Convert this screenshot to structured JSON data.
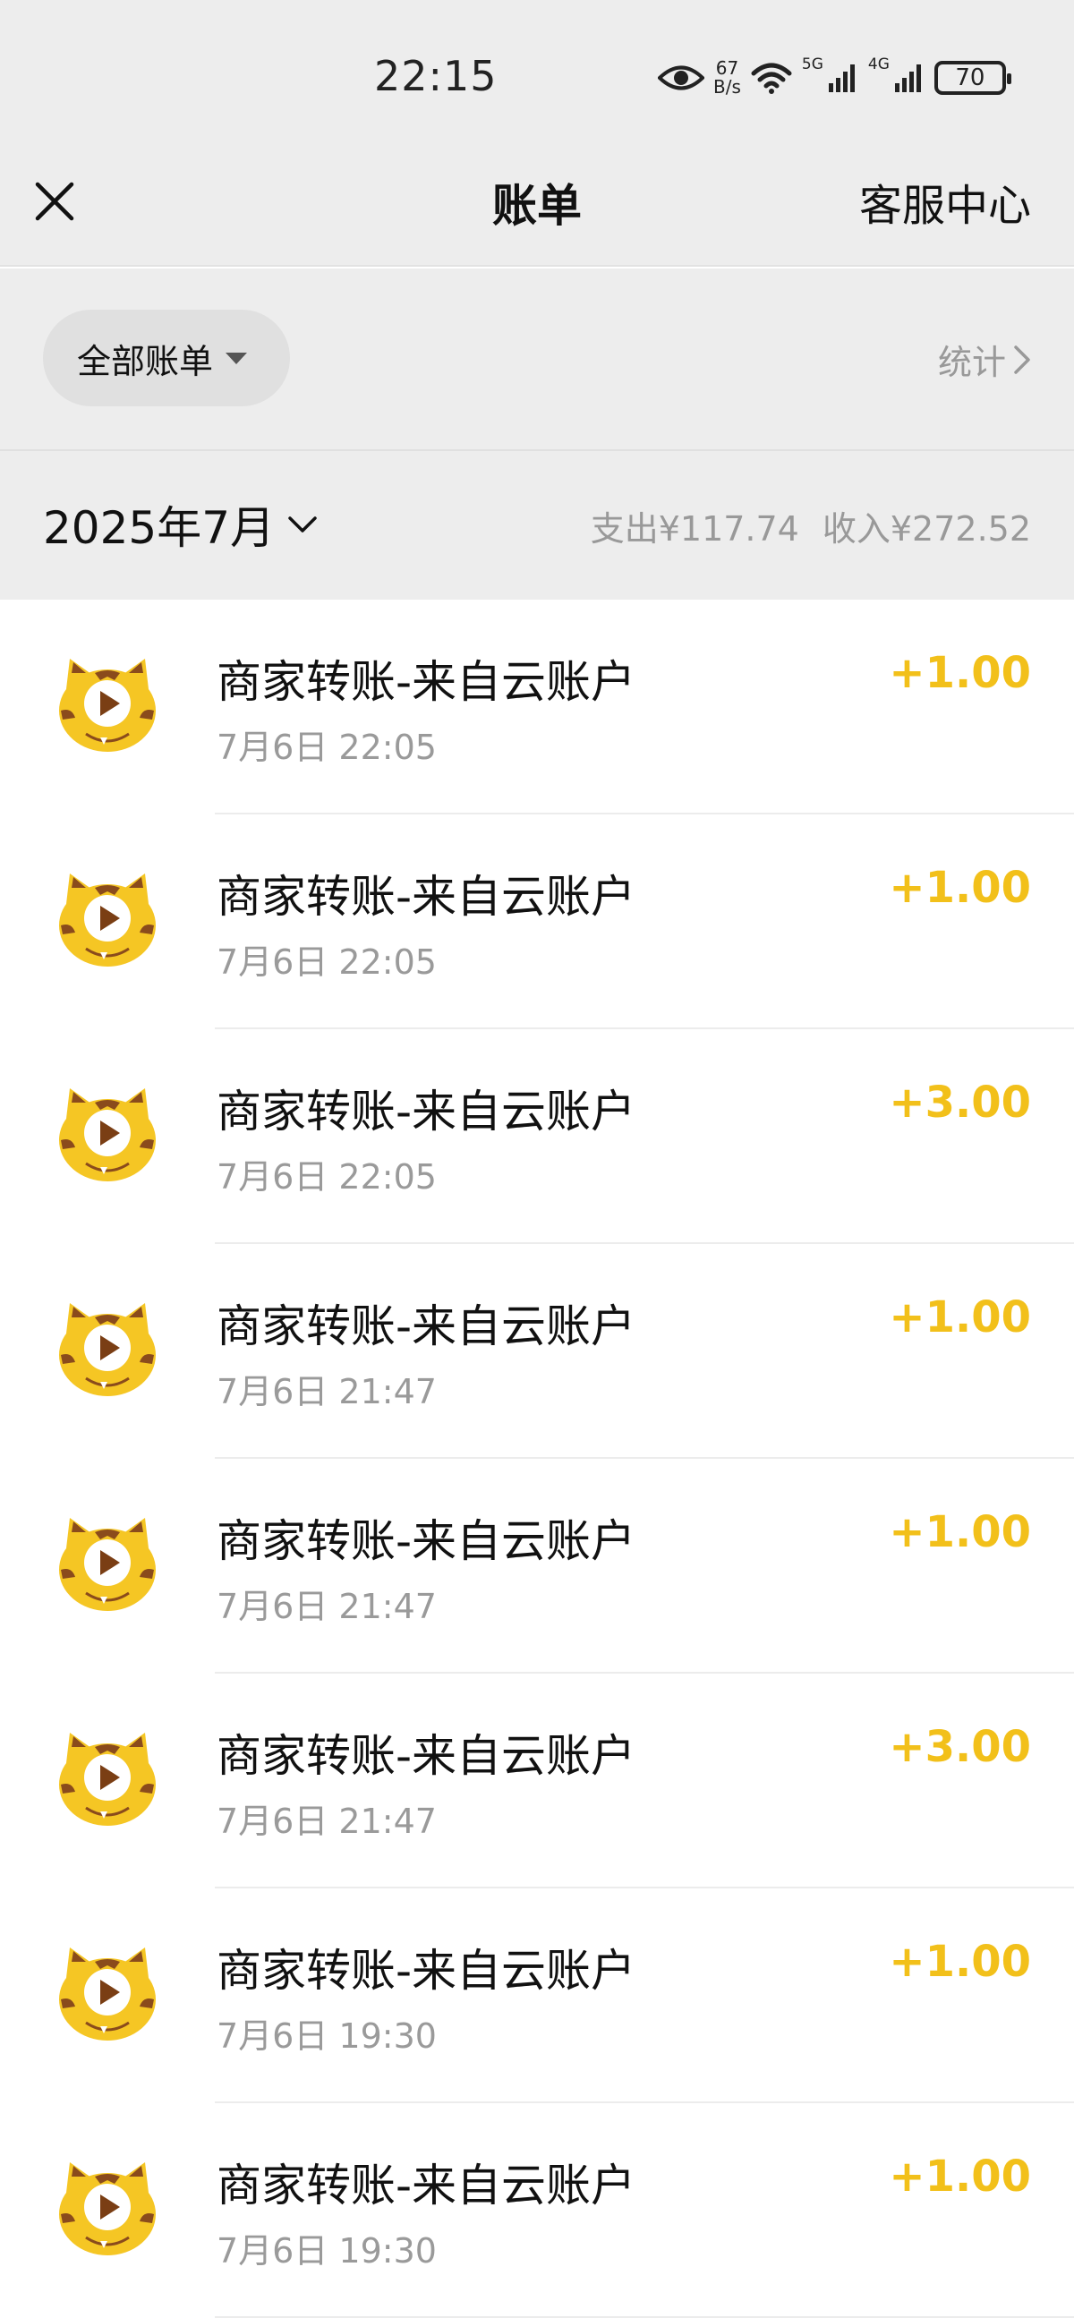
{
  "status_bar": {
    "time": "22:15",
    "net_speed_value": "67",
    "net_speed_unit": "B/s",
    "sim1": "5G",
    "sim2": "4G",
    "battery": "70"
  },
  "nav": {
    "title": "账单",
    "service": "客服中心"
  },
  "filter": {
    "label": "全部账单",
    "stats": "统计"
  },
  "month": {
    "label": "2025年7月",
    "expense": "支出¥117.74",
    "income": "收入¥272.52"
  },
  "transactions": [
    {
      "title": "商家转账-来自云账户",
      "time": "7月6日 22:05",
      "amount": "+1.00"
    },
    {
      "title": "商家转账-来自云账户",
      "time": "7月6日 22:05",
      "amount": "+1.00"
    },
    {
      "title": "商家转账-来自云账户",
      "time": "7月6日 22:05",
      "amount": "+3.00"
    },
    {
      "title": "商家转账-来自云账户",
      "time": "7月6日 21:47",
      "amount": "+1.00"
    },
    {
      "title": "商家转账-来自云账户",
      "time": "7月6日 21:47",
      "amount": "+1.00"
    },
    {
      "title": "商家转账-来自云账户",
      "time": "7月6日 21:47",
      "amount": "+3.00"
    },
    {
      "title": "商家转账-来自云账户",
      "time": "7月6日 19:30",
      "amount": "+1.00"
    },
    {
      "title": "商家转账-来自云账户",
      "time": "7月6日 19:30",
      "amount": "+1.00"
    }
  ],
  "colors": {
    "income_amount": "#f2c01a",
    "header_bg": "#ededed",
    "avatar": "#f5c624"
  },
  "icons": {
    "close": "close-icon",
    "chevron": "chevron-right-icon",
    "dropdown": "caret-down-icon",
    "avatar": "tiger-mascot-icon"
  }
}
